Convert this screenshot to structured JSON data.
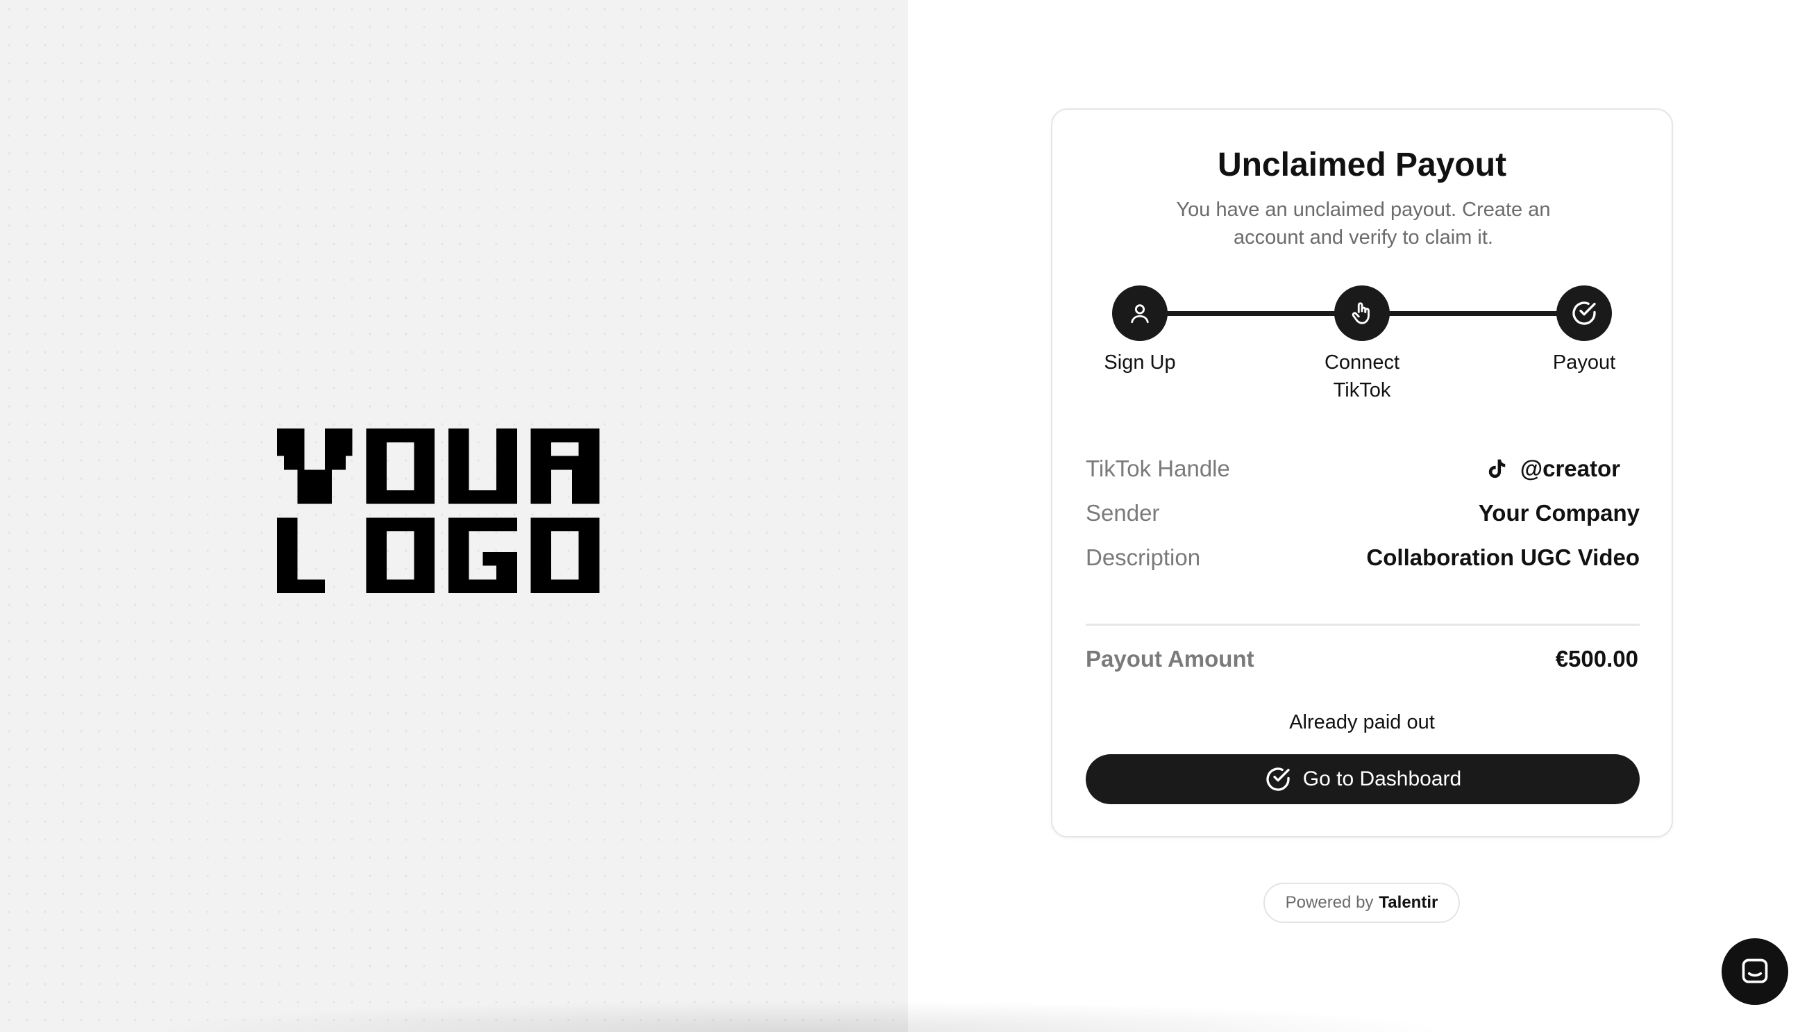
{
  "logo": {
    "line1": "YOUR",
    "line2": "LOGO"
  },
  "card": {
    "title": "Unclaimed Payout",
    "subtitle": "You have an unclaimed payout. Create an account and verify to claim it.",
    "steps": [
      {
        "label": "Sign Up",
        "icon": "user-icon"
      },
      {
        "label": "Connect TikTok",
        "icon": "pointer-hand-icon"
      },
      {
        "label": "Payout",
        "icon": "check-circle-icon"
      }
    ],
    "details": [
      {
        "label": "TikTok Handle",
        "value": "@creator",
        "icon": "tiktok-icon"
      },
      {
        "label": "Sender",
        "value": "Your Company"
      },
      {
        "label": "Description",
        "value": "Collaboration UGC Video"
      }
    ],
    "amount_label": "Payout Amount",
    "amount_value": "€500.00",
    "status": "Already paid out",
    "button_label": "Go to Dashboard"
  },
  "footer": {
    "powered_prefix": "Powered by",
    "powered_brand": "Talentir"
  },
  "chat": {
    "icon": "chat-icon"
  },
  "colors": {
    "accent": "#1a1a1a",
    "muted": "#7a7a7a",
    "left_bg": "#f2f2f2"
  }
}
